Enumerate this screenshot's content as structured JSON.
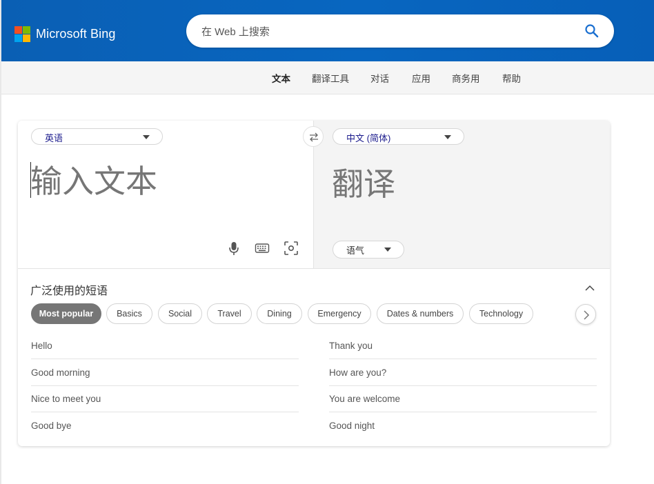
{
  "header": {
    "brand": "Microsoft Bing",
    "logo_colors": [
      "#f25022",
      "#7fba00",
      "#00a4ef",
      "#ffb900"
    ],
    "search_placeholder": "在 Web 上搜索",
    "search_icon": "search-icon"
  },
  "nav": {
    "items": [
      {
        "label": "文本",
        "active": true
      },
      {
        "label": "翻译工具",
        "active": false
      },
      {
        "label": "对话",
        "active": false
      },
      {
        "label": "应用",
        "active": false
      },
      {
        "label": "商务用",
        "active": false
      },
      {
        "label": "帮助",
        "active": false
      }
    ]
  },
  "translator": {
    "source_language": "英语",
    "target_language": "中文 (简体)",
    "source_placeholder": "输入文本",
    "target_placeholder": "翻译",
    "tone_label": "语气",
    "tools": [
      "microphone-icon",
      "keyboard-icon",
      "camera-scan-icon"
    ]
  },
  "phrases": {
    "title": "广泛使用的短语",
    "categories": [
      {
        "label": "Most popular",
        "active": true
      },
      {
        "label": "Basics",
        "active": false
      },
      {
        "label": "Social",
        "active": false
      },
      {
        "label": "Travel",
        "active": false
      },
      {
        "label": "Dining",
        "active": false
      },
      {
        "label": "Emergency",
        "active": false
      },
      {
        "label": "Dates & numbers",
        "active": false
      },
      {
        "label": "Technology",
        "active": false
      }
    ],
    "left": [
      "Hello",
      "Good morning",
      "Nice to meet you",
      "Good bye"
    ],
    "right": [
      "Thank you",
      "How are you?",
      "You are welcome",
      "Good night"
    ]
  },
  "colors": {
    "header_bg": "#0866c0",
    "active_chip": "#767676",
    "language_text": "#1a1a8c"
  }
}
